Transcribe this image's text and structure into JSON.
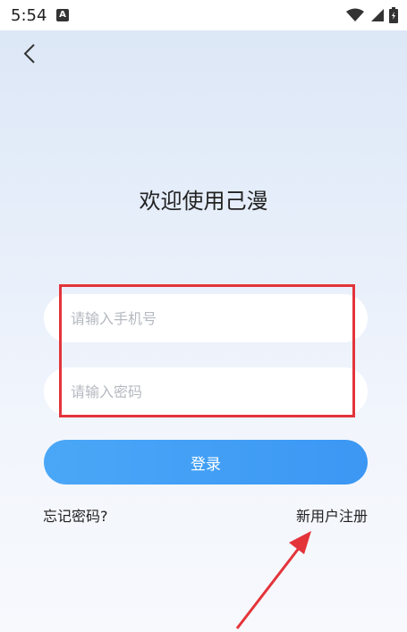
{
  "status_bar": {
    "time": "5:54",
    "notification_icon": "a-letter-icon",
    "icons": [
      "wifi-icon",
      "signal-icon",
      "battery-icon"
    ]
  },
  "header": {
    "back_icon": "chevron-left-icon"
  },
  "main": {
    "title": "欢迎使用己漫",
    "phone_placeholder": "请输入手机号",
    "password_placeholder": "请输入密码",
    "login_label": "登录",
    "forgot_label": "忘记密码?",
    "register_label": "新用户注册"
  },
  "colors": {
    "accent": "#3b97f3",
    "annotation": "#e3343a",
    "background_top": "#dbe6f6"
  }
}
